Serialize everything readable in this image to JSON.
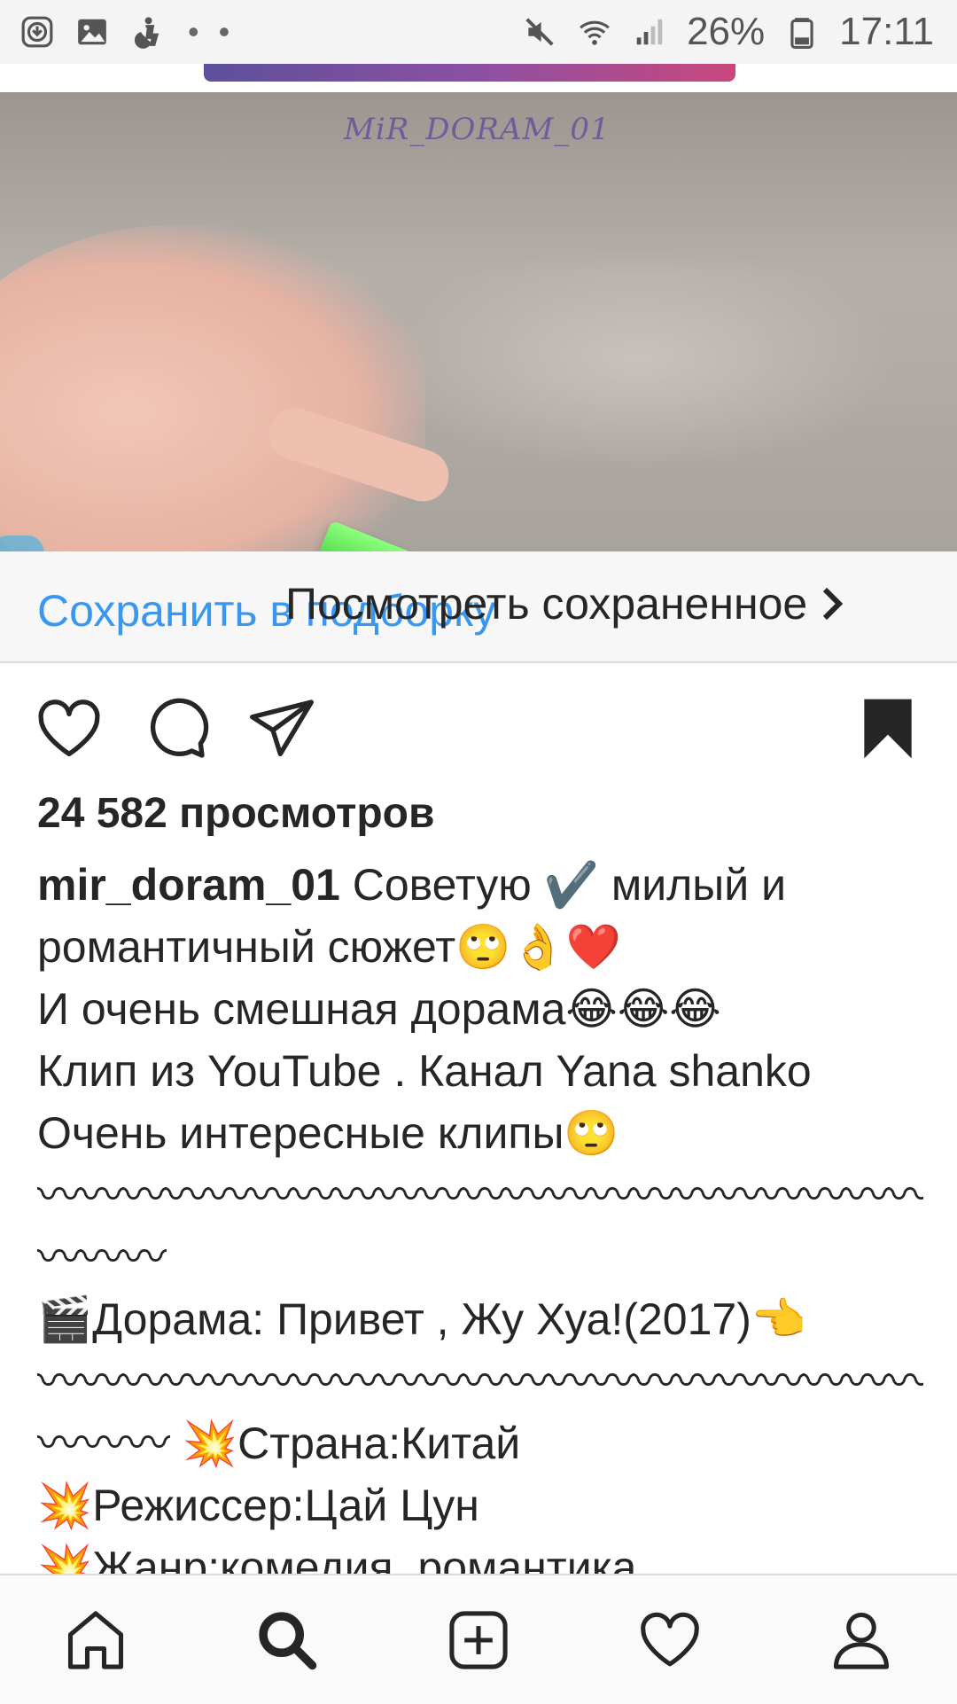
{
  "status_bar": {
    "icons": [
      "download-icon",
      "gallery-icon",
      "accessibility-icon",
      "more-notifications-icon"
    ],
    "battery": "26%",
    "time": "17:11",
    "right_icons": [
      "mute-icon",
      "wifi-icon",
      "signal-icon",
      "battery-icon"
    ]
  },
  "video": {
    "watermark": "MiR_DORAM_01"
  },
  "save_bar": {
    "save_label": "Сохранить в подборку",
    "view_saved_label": "Посмотреть сохраненное"
  },
  "actions": {
    "icons": [
      "like-heart-icon",
      "comment-icon",
      "share-direct-icon",
      "bookmark-saved-icon"
    ],
    "saved": true
  },
  "post": {
    "views": "24 582 просмотров",
    "username": "mir_doram_01",
    "caption_lines": [
      "Советую ✔️ милый и",
      "романтичный сюжет🙄👌❤️",
      "И очень  смешная  дорама😂😂😂",
      "Клип из YouTube . Канал Yana shanko",
      "Очень  интересные клипы🙄",
      "〰〰〰〰〰〰〰〰〰〰〰〰〰〰〰〰〰〰〰〰〰〰〰〰〰〰〰〰〰〰",
      "〰〰〰",
      "🎬Дорама: Привет , Жу Хуа!(2017)👈",
      "〰〰〰〰〰〰〰〰〰〰〰〰〰〰〰〰〰〰〰〰〰〰〰〰〰〰〰〰〰〰",
      "〰〰〰 💥Страна:Китай",
      "💥Режиссер:Цай Цун",
      "💥Жанр:комедия, романтика"
    ]
  },
  "bottom_nav": {
    "items": [
      "home-icon",
      "search-icon",
      "new-post-icon",
      "activity-heart-icon",
      "profile-icon"
    ]
  },
  "colors": {
    "link_blue": "#3897f0",
    "text": "#262626",
    "divider": "#dbdbdb",
    "status_bg": "#f4f4f4"
  }
}
